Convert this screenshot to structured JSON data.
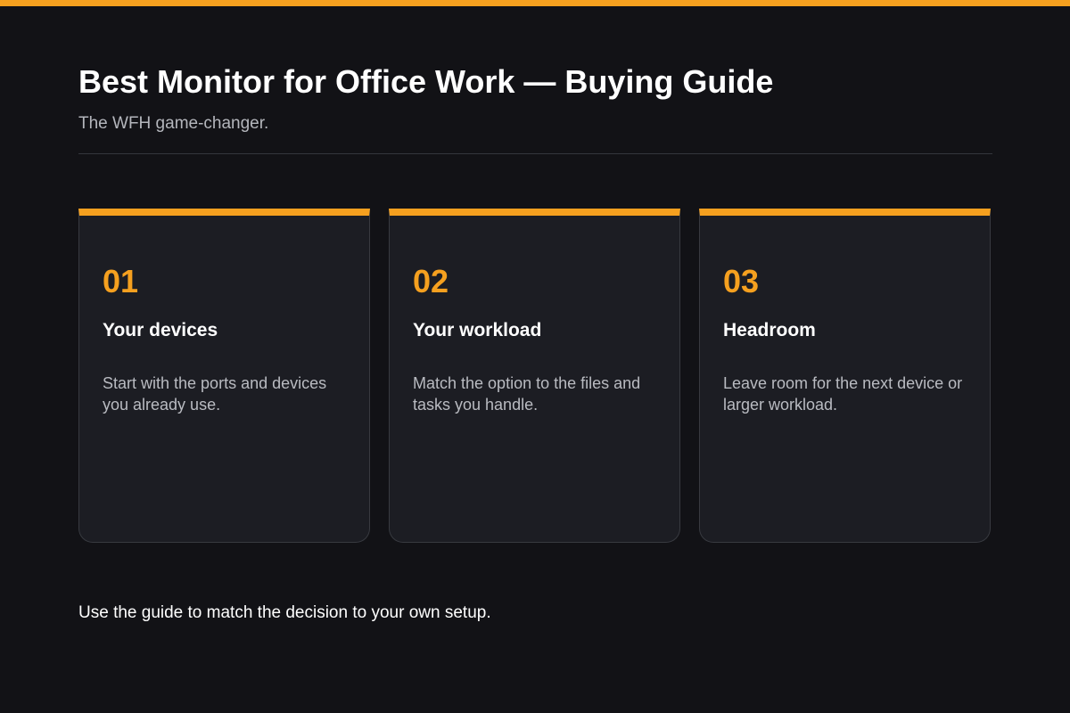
{
  "header": {
    "title": "Best Monitor for Office Work — Buying Guide",
    "subtitle": "The WFH game-changer."
  },
  "cards": [
    {
      "number": "01",
      "title": "Your devices",
      "text": "Start with the ports and devices you already use."
    },
    {
      "number": "02",
      "title": "Your workload",
      "text": "Match the option to the files and tasks you handle."
    },
    {
      "number": "03",
      "title": "Headroom",
      "text": "Leave room for the next device or larger workload."
    }
  ],
  "footer": {
    "text": "Use the guide to match the decision to your own setup."
  },
  "colors": {
    "accent": "#f5a01f",
    "background": "#121216",
    "card_background": "#1c1d23"
  }
}
